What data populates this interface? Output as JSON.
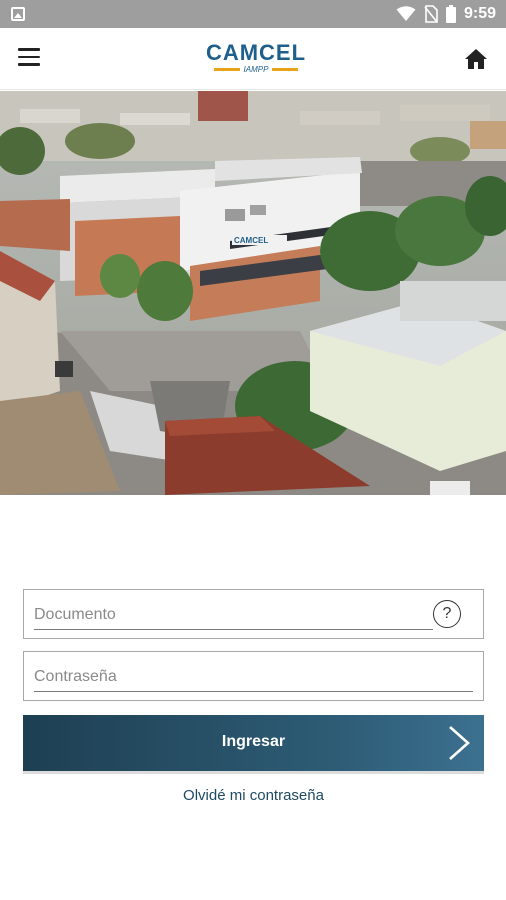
{
  "status_bar": {
    "time": "9:59",
    "icons": [
      "image-icon",
      "wifi-icon",
      "no-sim-icon",
      "battery-icon"
    ]
  },
  "header": {
    "logo_brand": "CAMCEL",
    "logo_sub": "IAMPP",
    "menu_icon": "hamburger-menu-icon",
    "home_icon": "home-icon"
  },
  "hero": {
    "image": "aerial-photo-camcel-building",
    "building_sign": "CAMCEL"
  },
  "login": {
    "document_placeholder": "Documento",
    "document_value": "",
    "password_placeholder": "Contraseña",
    "password_value": "",
    "help_label": "?",
    "submit_label": "Ingresar",
    "forgot_label": "Olvidé mi contraseña"
  },
  "colors": {
    "brand_blue": "#1f5f8b",
    "brand_orange": "#e8a317",
    "button_dark": "#1e3f52",
    "status_bar": "#9e9e9e"
  }
}
